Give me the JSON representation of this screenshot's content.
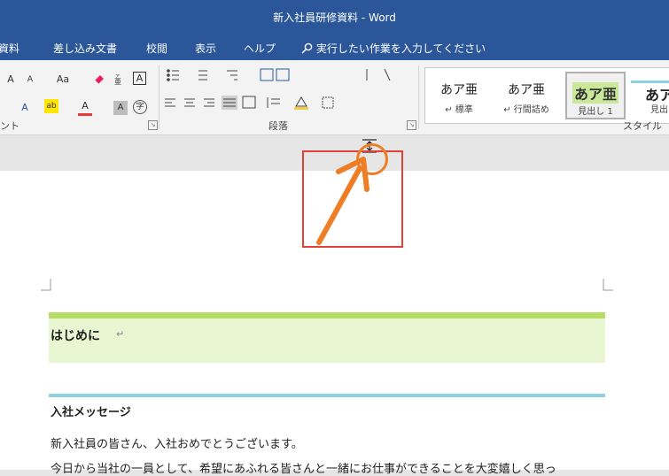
{
  "window": {
    "title": "新入社員研修資料  -  Word"
  },
  "tabs": [
    {
      "label": "資料"
    },
    {
      "label": "差し込み文書"
    },
    {
      "label": "校閲"
    },
    {
      "label": "表示"
    },
    {
      "label": "ヘルプ"
    }
  ],
  "tell_me": {
    "placeholder": "実行したい作業を入力してください"
  },
  "ribbon": {
    "groups": {
      "font": "ント",
      "paragraph": "段落",
      "styles": "スタイル"
    },
    "font_buttons": {
      "grow": "A",
      "shrink": "A",
      "change_case": "Aa",
      "clear": "A",
      "effects": "A",
      "highlight": "ab",
      "color": "A",
      "shade": "A",
      "circle_char": "字"
    },
    "styles": [
      {
        "sample": "あア亜",
        "name": "↵ 標準"
      },
      {
        "sample": "あア亜",
        "name": "↵ 行間詰め"
      },
      {
        "sample": "あア亜",
        "name": "見出し 1"
      },
      {
        "sample": "あア",
        "name": "見出"
      }
    ]
  },
  "document": {
    "heading1": "はじめに",
    "heading2": "入社メッセージ",
    "body_line1": "新入社員の皆さん、入社おめでとうございます。",
    "body_line2": "今日から当社の一員として、希望にあふれる皆さんと一緒にお仕事ができることを大変嬉しく思っ"
  },
  "colors": {
    "accent": "#2b579a",
    "highlight_box": "#e0423a",
    "arrow": "#ef7d25",
    "h1_bar": "#b6dc64",
    "h2_line": "#8ed2e0"
  }
}
